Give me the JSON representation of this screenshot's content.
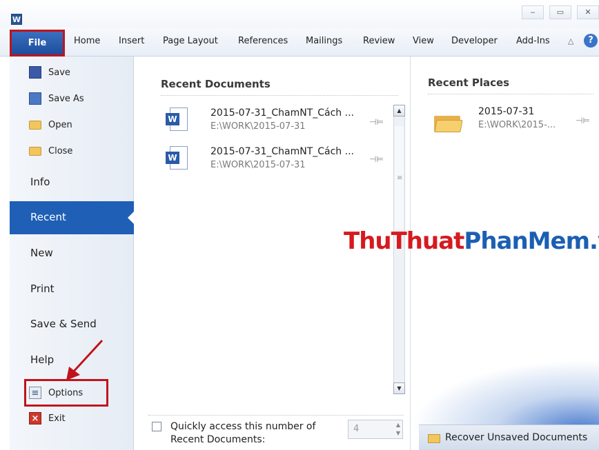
{
  "app": {
    "icon_letter": "W"
  },
  "window_controls": {
    "minimize": "‒",
    "maximize": "▭",
    "close": "✕"
  },
  "tabs": {
    "file": "File",
    "items": [
      "Home",
      "Insert",
      "Page Layout",
      "References",
      "Mailings",
      "Review",
      "View",
      "Developer",
      "Add-Ins"
    ]
  },
  "nav": {
    "save": "Save",
    "save_as": "Save As",
    "open": "Open",
    "close": "Close",
    "info": "Info",
    "recent": "Recent",
    "new": "New",
    "print": "Print",
    "save_send": "Save & Send",
    "help": "Help",
    "options": "Options",
    "exit": "Exit"
  },
  "recent_documents": {
    "title": "Recent Documents",
    "items": [
      {
        "name": "2015-07-31_ChamNT_Cách ...",
        "path": "E:\\WORK\\2015-07-31"
      },
      {
        "name": "2015-07-31_ChamNT_Cách ...",
        "path": "E:\\WORK\\2015-07-31"
      }
    ],
    "quick_access_label": "Quickly access this number of Recent Documents:",
    "quick_access_count": "4"
  },
  "recent_places": {
    "title": "Recent Places",
    "items": [
      {
        "name": "2015-07-31",
        "path": "E:\\WORK\\2015-..."
      }
    ],
    "recover_label": "Recover Unsaved Documents"
  },
  "watermark": {
    "part1": "ThuThuat",
    "part2": "PhanMem.vn"
  },
  "colors": {
    "accent": "#1f5fb5",
    "highlight": "#c0141c"
  }
}
